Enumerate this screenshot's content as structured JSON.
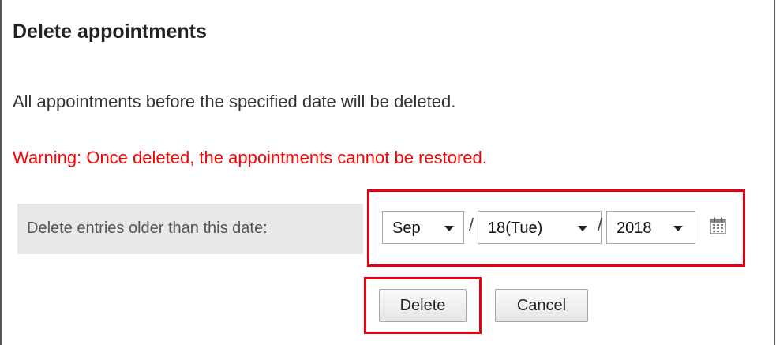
{
  "title": "Delete appointments",
  "description": "All appointments before the specified date will be deleted.",
  "warning": {
    "text": "Warning: Once deleted, the appointments cannot be restored.",
    "color": "#ff0000"
  },
  "date_row": {
    "label": "Delete entries older than this date:",
    "month": "Sep",
    "day": "18(Tue)",
    "year": "2018",
    "separator": "/",
    "calendar_icon": "calendar-icon"
  },
  "buttons": {
    "delete": "Delete",
    "cancel": "Cancel"
  },
  "colors": {
    "highlight": "#e60012",
    "label_background": "#e8e8e8"
  }
}
